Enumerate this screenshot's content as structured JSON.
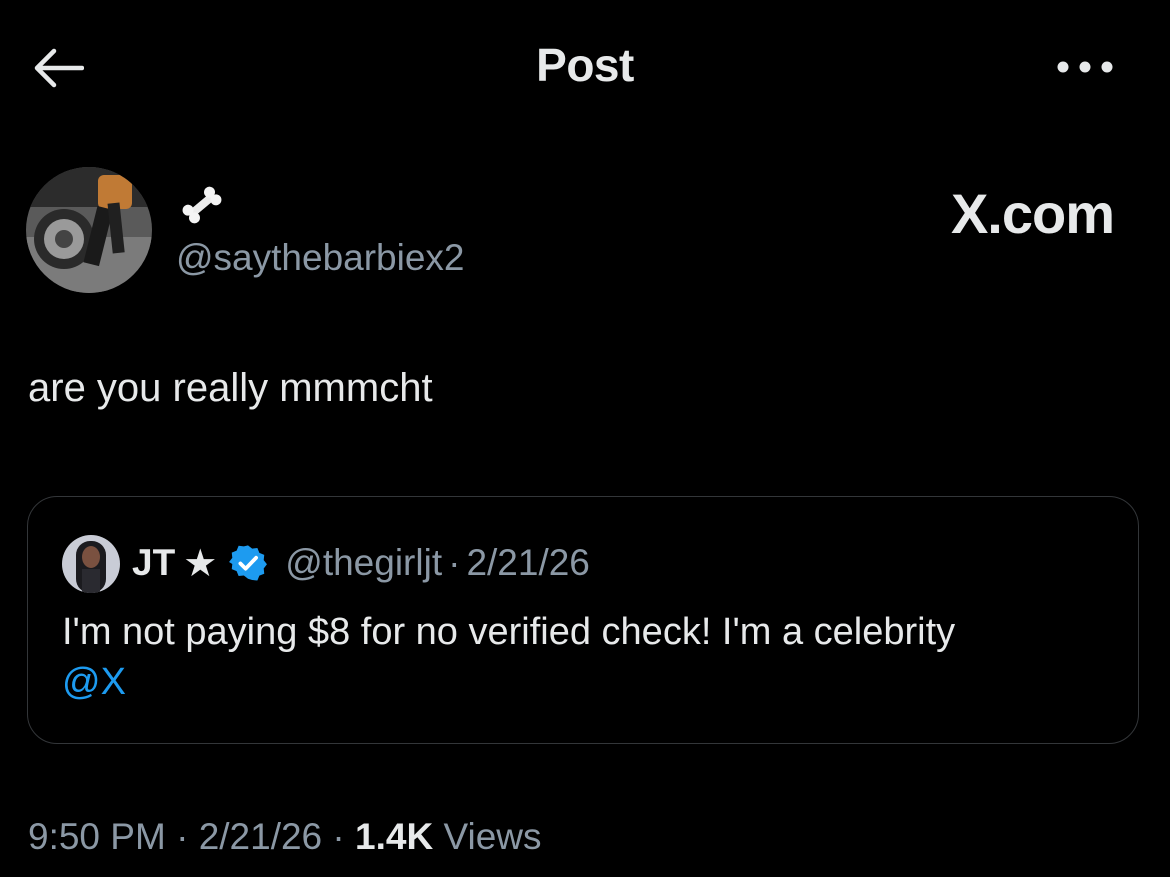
{
  "header": {
    "title": "Post",
    "back_icon": "arrow-left-icon",
    "more_icon": "more-horizontal-icon"
  },
  "author": {
    "display_name_icon": "bone-emoji",
    "handle": "@saythebarbiex2",
    "watermark": "X.com"
  },
  "post": {
    "text": "are you really mmmcht"
  },
  "quote": {
    "name": "JT",
    "star": "★",
    "verified_icon": "verified-badge-icon",
    "handle": "@thegirljt",
    "separator": "·",
    "date": "2/21/26",
    "text": "I'm not paying $8 for no verified check! I'm a celebrity",
    "mention": "@X"
  },
  "meta": {
    "time": "9:50 PM",
    "sep1": " · ",
    "date": "2/21/26",
    "sep2": " · ",
    "views_count": "1.4K",
    "views_label": " Views"
  },
  "colors": {
    "background": "#000000",
    "text": "#e7e9ea",
    "secondary": "#8b98a5",
    "link": "#1d9bf0",
    "border": "#333639"
  }
}
